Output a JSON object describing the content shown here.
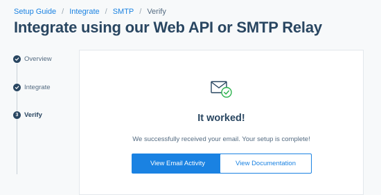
{
  "breadcrumb": {
    "items": [
      "Setup Guide",
      "Integrate",
      "SMTP"
    ],
    "separator": "/",
    "current": "Verify"
  },
  "page": {
    "title": "Integrate using our Web API or SMTP Relay"
  },
  "steps": [
    {
      "label": "Overview",
      "state": "complete",
      "icon": "check-icon"
    },
    {
      "label": "Integrate",
      "state": "complete",
      "icon": "check-icon"
    },
    {
      "label": "Verify",
      "state": "active",
      "number": "3"
    }
  ],
  "result": {
    "icon": "email-success-icon",
    "heading": "It worked!",
    "message": "We successfully received your email. Your setup is complete!",
    "primary_button": "View Email Activity",
    "secondary_button": "View Documentation"
  },
  "colors": {
    "brand": "#1a82e2",
    "text_dark": "#294661",
    "text_muted": "#546b81",
    "success": "#2bb24c",
    "background": "#f7f9fa"
  }
}
